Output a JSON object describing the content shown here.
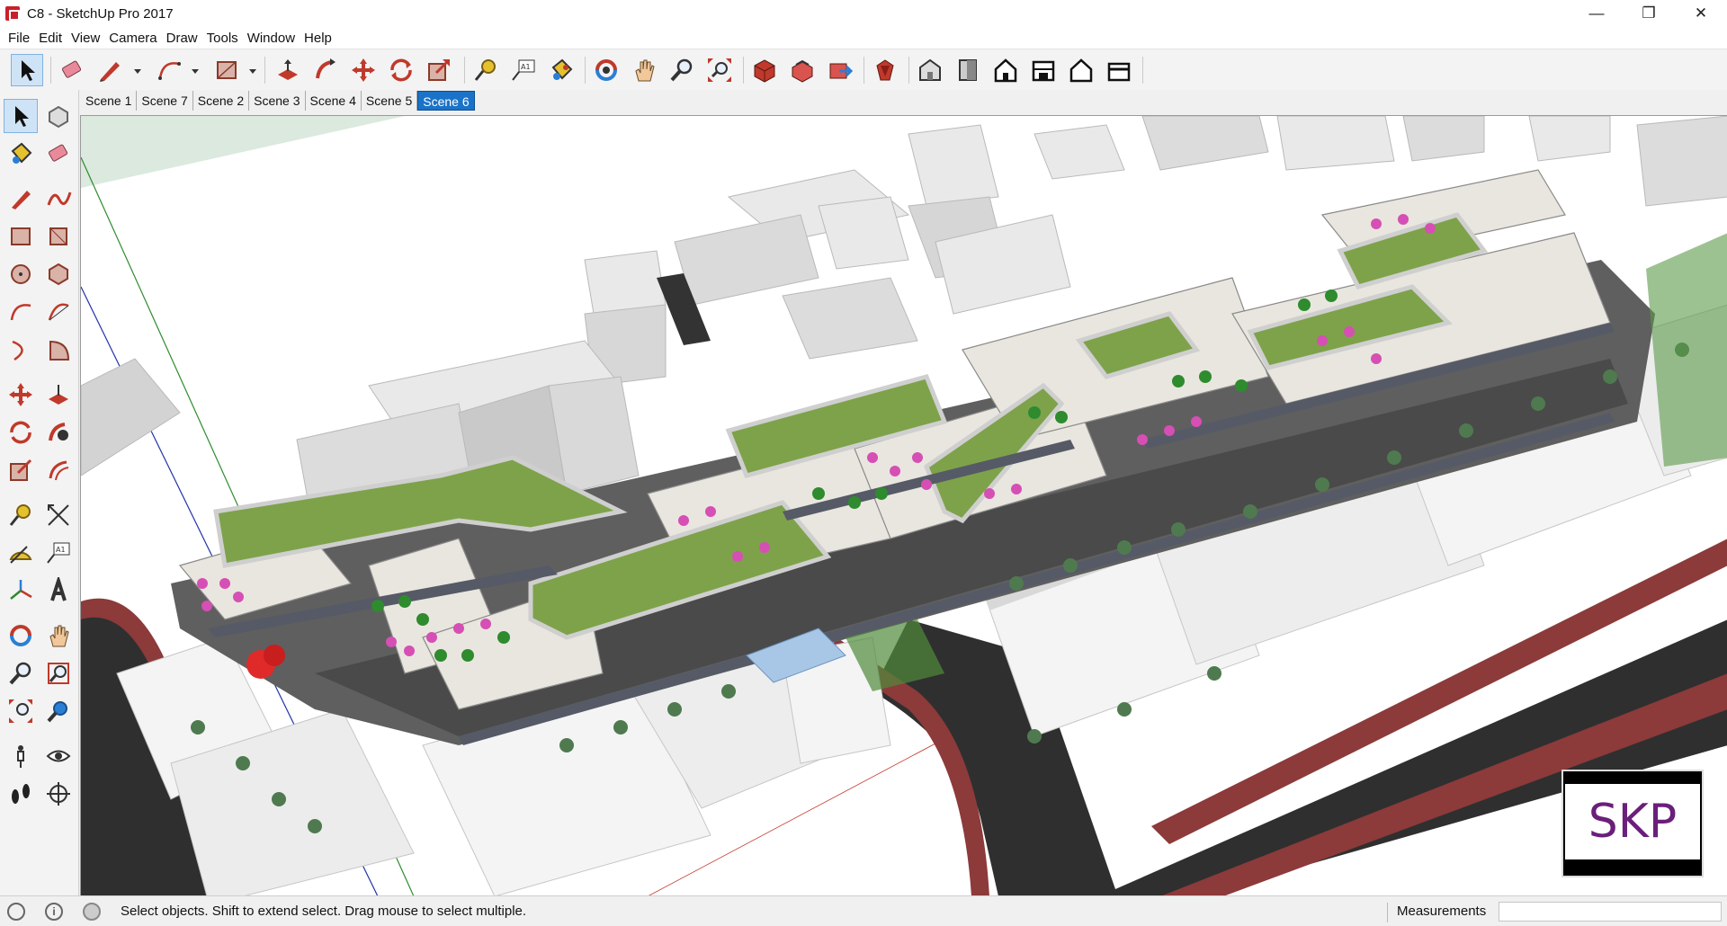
{
  "window": {
    "title": "C8 - SketchUp Pro 2017",
    "minimize": "—",
    "maximize": "❐",
    "close": "✕"
  },
  "menu": [
    "File",
    "Edit",
    "View",
    "Camera",
    "Draw",
    "Tools",
    "Window",
    "Help"
  ],
  "scene_tabs": [
    "Scene 1",
    "Scene 7",
    "Scene 2",
    "Scene 3",
    "Scene 4",
    "Scene 5",
    "Scene 6"
  ],
  "active_scene": "Scene 6",
  "status": {
    "hint": "Select objects. Shift to extend select. Drag mouse to select multiple.",
    "measurements_label": "Measurements",
    "measurements_value": ""
  },
  "watermark": {
    "text": "SKP"
  },
  "colors": {
    "roof_green": "#7ea24a",
    "terrace": "#e9e6df",
    "road": "#2f2f2f",
    "road_edge": "#8c3a3a",
    "umbrella_pink": "#d64fb4",
    "tree_green": "#2e8b2e",
    "active_blue": "#1a73c8"
  }
}
